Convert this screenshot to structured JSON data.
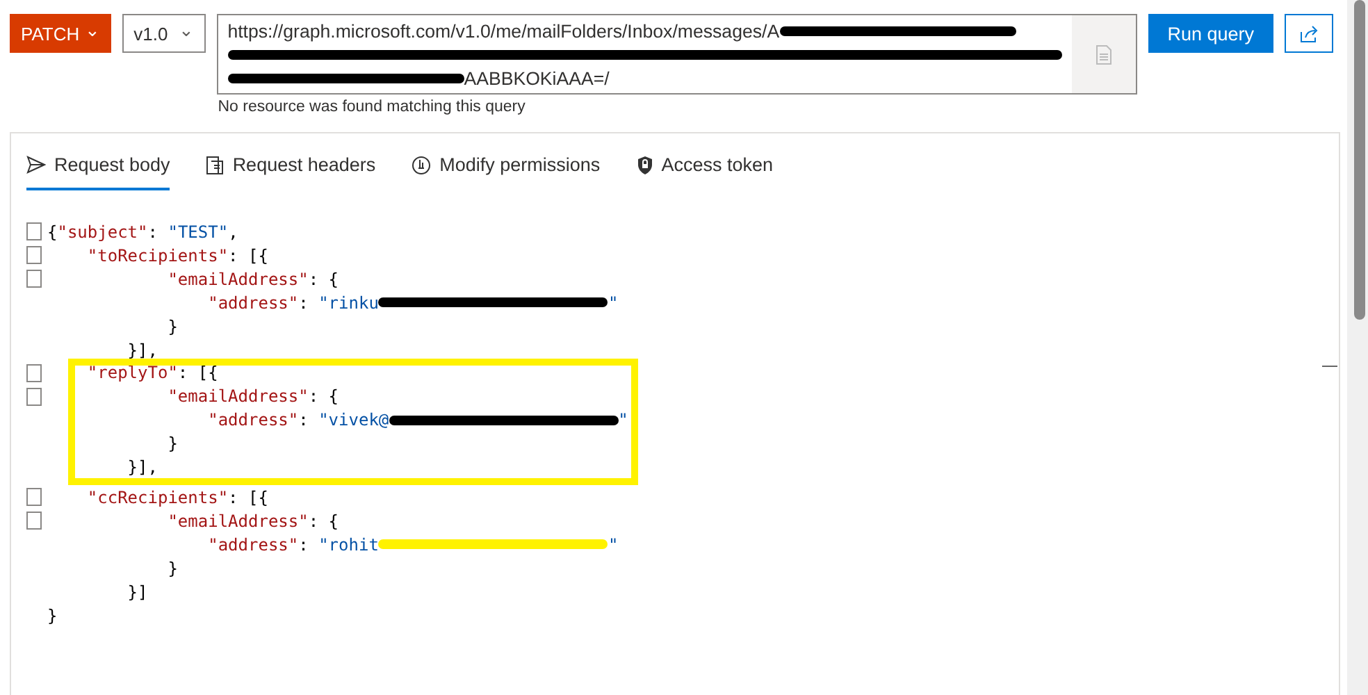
{
  "method": {
    "label": "PATCH",
    "caret": "⌄"
  },
  "version": {
    "label": "v1.0",
    "caret": "⌄"
  },
  "url_lines": [
    [
      {
        "kind": "text",
        "text": "https://graph.microsoft.com/v1.0/me/mailFolders/Inbox/messages/A"
      },
      {
        "kind": "redaction",
        "color": "#000000"
      }
    ],
    [
      {
        "kind": "redaction",
        "color": "#000000"
      }
    ],
    [
      {
        "kind": "redaction",
        "color": "#000000"
      },
      {
        "kind": "text",
        "text": "AABBKOKiAAA=/"
      }
    ]
  ],
  "url_message": "No resource was found matching this query",
  "run_button": "Run query",
  "tabs": [
    {
      "label": "Request body",
      "selected": true
    },
    {
      "label": "Request headers",
      "selected": false
    },
    {
      "label": "Modify permissions",
      "selected": false
    },
    {
      "label": "Access token",
      "selected": false
    }
  ],
  "code_blocks": [
    {
      "highlighted": false,
      "lines": [
        {
          "fold": true,
          "tokens": [
            {
              "kind": "punct",
              "text": "{"
            },
            {
              "kind": "key",
              "text": "\"subject\""
            },
            {
              "kind": "punct",
              "text": ": "
            },
            {
              "kind": "string",
              "text": "\"TEST\""
            },
            {
              "kind": "punct",
              "text": ","
            }
          ]
        },
        {
          "fold": true,
          "tokens": [
            {
              "kind": "key",
              "text": "    \"toRecipients\""
            },
            {
              "kind": "punct",
              "text": ": [{"
            }
          ]
        },
        {
          "fold": true,
          "tokens": [
            {
              "kind": "key",
              "text": "            \"emailAddress\""
            },
            {
              "kind": "punct",
              "text": ": {"
            }
          ]
        },
        {
          "fold": false,
          "tokens": [
            {
              "kind": "key",
              "text": "                \"address\""
            },
            {
              "kind": "punct",
              "text": ": "
            },
            {
              "kind": "string",
              "text": "\"rinku"
            },
            {
              "kind": "redaction",
              "color": "#000000"
            },
            {
              "kind": "string",
              "text": "\""
            }
          ]
        },
        {
          "fold": false,
          "tokens": [
            {
              "kind": "punct",
              "text": "            }"
            }
          ]
        },
        {
          "fold": false,
          "tokens": [
            {
              "kind": "punct",
              "text": "        }],"
            }
          ]
        }
      ]
    },
    {
      "highlighted": true,
      "lines": [
        {
          "fold": true,
          "tokens": [
            {
              "kind": "key",
              "text": "    \"replyTo\""
            },
            {
              "kind": "punct",
              "text": ": [{"
            }
          ]
        },
        {
          "fold": true,
          "tokens": [
            {
              "kind": "key",
              "text": "            \"emailAddress\""
            },
            {
              "kind": "punct",
              "text": ": {"
            }
          ]
        },
        {
          "fold": false,
          "tokens": [
            {
              "kind": "key",
              "text": "                \"address\""
            },
            {
              "kind": "punct",
              "text": ": "
            },
            {
              "kind": "string",
              "text": "\"vivek@"
            },
            {
              "kind": "redaction",
              "color": "#000000"
            },
            {
              "kind": "string",
              "text": "\""
            }
          ]
        },
        {
          "fold": false,
          "tokens": [
            {
              "kind": "punct",
              "text": "            }"
            }
          ]
        },
        {
          "fold": false,
          "tokens": [
            {
              "kind": "punct",
              "text": "        }],"
            }
          ]
        }
      ]
    },
    {
      "highlighted": false,
      "lines": [
        {
          "fold": true,
          "tokens": [
            {
              "kind": "key",
              "text": "    \"ccRecipients\""
            },
            {
              "kind": "punct",
              "text": ": [{"
            }
          ]
        },
        {
          "fold": true,
          "tokens": [
            {
              "kind": "key",
              "text": "            \"emailAddress\""
            },
            {
              "kind": "punct",
              "text": ": {"
            }
          ]
        },
        {
          "fold": false,
          "tokens": [
            {
              "kind": "key",
              "text": "                \"address\""
            },
            {
              "kind": "punct",
              "text": ": "
            },
            {
              "kind": "string",
              "text": "\"rohit"
            },
            {
              "kind": "redaction",
              "color": "#fff200"
            },
            {
              "kind": "string",
              "text": "\""
            }
          ]
        },
        {
          "fold": false,
          "tokens": [
            {
              "kind": "punct",
              "text": "            }"
            }
          ]
        },
        {
          "fold": false,
          "tokens": [
            {
              "kind": "punct",
              "text": "        }]"
            }
          ]
        },
        {
          "fold": false,
          "tokens": [
            {
              "kind": "punct",
              "text": "}"
            }
          ]
        }
      ]
    }
  ]
}
